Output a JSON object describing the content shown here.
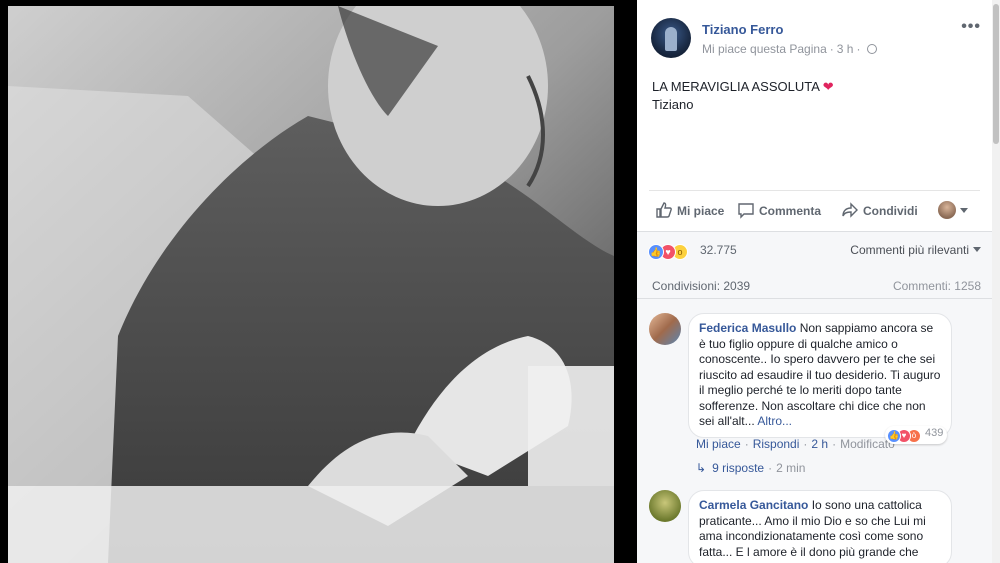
{
  "post": {
    "page_name": "Tiziano Ferro",
    "like_page": "Mi piace questa Pagina",
    "time": "3 h",
    "text_line1": "LA MERAVIGLIA ASSOLUTA",
    "text_line2": "Tiziano",
    "more_icon_text": "•••",
    "heart_emoji": "❤"
  },
  "actions": {
    "like": "Mi piace",
    "comment": "Commenta",
    "share": "Condividi"
  },
  "reactions": {
    "count": "32.775",
    "sort_label": "Commenti più rilevanti",
    "shares": "Condivisioni: 2039",
    "comments": "Commenti: 1258"
  },
  "comments": [
    {
      "author": "Federica Masullo",
      "text": "Non sappiamo ancora se è tuo figlio oppure di qualche amico o conoscente.. Io spero davvero per te che sei riuscito ad esaudire il tuo desiderio. Ti auguro il meglio perché te lo meriti dopo tante sofferenze. Non ascoltare chi dice che non sei all'alt...",
      "more": "Altro...",
      "like": "Mi piace",
      "reply": "Rispondi",
      "time": "2 h",
      "edited": "Modificato",
      "reaction_count": "439",
      "replies": "9 risposte",
      "replies_time": "2 min"
    },
    {
      "author": "Carmela Gancitano",
      "text": "Io sono una cattolica praticante... Amo il mio Dio e so che Lui mi ama incondizionatamente così come sono fatta... E l amore è il dono più grande che"
    }
  ],
  "colors": {
    "link_blue": "#365899",
    "like_blue": "#5890ff",
    "love_red": "#f25268",
    "wow_yellow": "#fcd13e"
  }
}
